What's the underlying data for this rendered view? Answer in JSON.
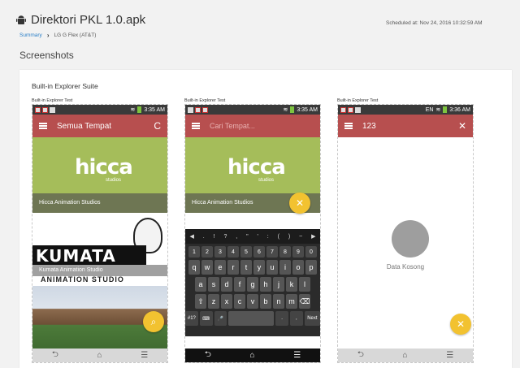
{
  "header": {
    "app_title": "Direktori PKL 1.0.apk",
    "breadcrumb_link": "Summary",
    "breadcrumb_device": "LG G Flex (AT&T)",
    "scheduled": "Scheduled at: Nov 24, 2016 10:32:59 AM"
  },
  "section_title": "Screenshots",
  "suite_title": "Built-in Explorer Suite",
  "screens": [
    {
      "label": "Built-in Explorer Test",
      "time": "3:35 AM",
      "toolbar_title": "Semua Tempat",
      "toolbar_action": "C",
      "tiles": [
        "Hicca Animation Studios",
        "Kumata Animation Studio"
      ],
      "hicca_logo": "hicca",
      "hicca_sub": "studios",
      "kumata_logo": "KUMATA",
      "kumata_studio": "ANIMATION STUDIO"
    },
    {
      "label": "Built-in Explorer Test",
      "time": "3:35 AM",
      "search_placeholder": "Cari Tempat...",
      "tiles": [
        "Hicca Animation Studios"
      ],
      "hicca_logo": "hicca",
      "hicca_sub": "studios",
      "keyboard": {
        "suggestions": [
          "◀",
          ".",
          "!",
          "?",
          ",",
          "\"",
          "'",
          ":",
          "(",
          ")",
          "~",
          "▶"
        ],
        "numbers": [
          "1",
          "2",
          "3",
          "4",
          "5",
          "6",
          "7",
          "8",
          "9",
          "0"
        ],
        "row1": [
          "q",
          "w",
          "e",
          "r",
          "t",
          "y",
          "u",
          "i",
          "o",
          "p"
        ],
        "row2": [
          "a",
          "s",
          "d",
          "f",
          "g",
          "h",
          "j",
          "k",
          "l"
        ],
        "row3": [
          "⇧",
          "z",
          "x",
          "c",
          "v",
          "b",
          "n",
          "m",
          "⌫"
        ],
        "row4_left": [
          "#1?",
          "⌨",
          "🎤"
        ],
        "row4_right": [
          ".",
          ",",
          "Next"
        ]
      }
    },
    {
      "label": "Built-in Explorer Test",
      "time": "3:36 AM",
      "status_lang": "EN",
      "toolbar_title": "123",
      "toolbar_action": "✕",
      "empty_text": "Data Kosong",
      "fab_symbol": "✕"
    }
  ],
  "nav": {
    "back": "⮌",
    "home": "⌂",
    "menu": "☰"
  },
  "fab_search": "⌕",
  "colors": {
    "toolbar": "#b74f4f",
    "fab": "#f2c230",
    "link": "#2a7fc8"
  }
}
